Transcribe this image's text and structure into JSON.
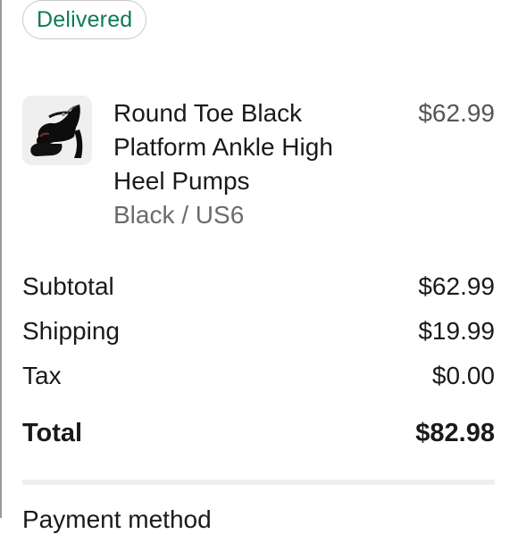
{
  "order": {
    "status": "Delivered"
  },
  "item": {
    "title": "Round Toe Black Platform Ankle High Heel Pumps",
    "title_lines": [
      "Round Toe Black",
      "Platform Ankle High",
      "Heel Pumps"
    ],
    "variant": "Black / US6",
    "price": "$62.99",
    "thumbnail_icon": "black-platform-heel-shoe-image"
  },
  "summary": {
    "subtotal_label": "Subtotal",
    "subtotal_value": "$62.99",
    "shipping_label": "Shipping",
    "shipping_value": "$19.99",
    "tax_label": "Tax",
    "tax_value": "$0.00",
    "total_label": "Total",
    "total_value": "$82.98"
  },
  "next_section": {
    "heading_partial": "Payment method"
  },
  "colors": {
    "status_green": "#0e7b57",
    "text": "#1a1a1a",
    "muted": "#6b6b6b"
  }
}
